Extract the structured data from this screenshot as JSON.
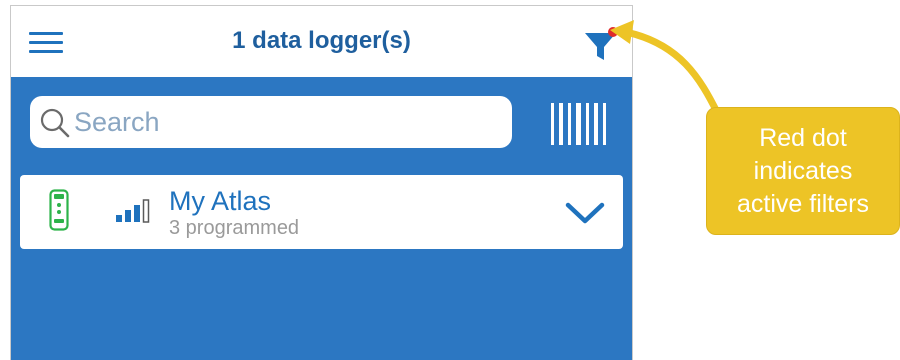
{
  "header": {
    "title": "1 data logger(s)",
    "menu_icon": "hamburger-menu-icon",
    "filter_icon": "funnel-filter-icon",
    "filter_active_indicator_color": "#e02b2b"
  },
  "search": {
    "placeholder": "Search",
    "search_icon": "magnifier-icon",
    "scan_icon": "barcode-scan-icon"
  },
  "loggers": [
    {
      "name": "My Atlas",
      "status": "3 programmed",
      "device_icon": "data-logger-device-icon",
      "signal_icon": "signal-strength-icon",
      "expand_icon": "chevron-down-icon"
    }
  ],
  "callout": {
    "lines": [
      "Red dot",
      "indicates",
      "active filters"
    ]
  },
  "colors": {
    "primary_blue": "#2c77c2",
    "title_blue": "#1f5f9e",
    "accent_green": "#2db34a",
    "callout_yellow": "#edc426"
  }
}
